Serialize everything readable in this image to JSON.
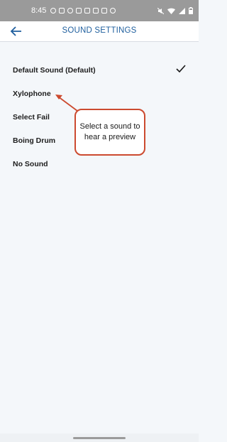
{
  "status_bar": {
    "time": "8:45",
    "icons": [
      "profile-icon",
      "mail-icon",
      "at-icon",
      "tower-icon",
      "media-icon",
      "clipboard-icon",
      "image-icon",
      "lock-icon"
    ],
    "right_icons": [
      "mute-icon",
      "wifi-icon",
      "signal-icon",
      "battery-icon"
    ]
  },
  "header": {
    "title": "SOUND SETTINGS",
    "back_icon": "back-arrow-icon"
  },
  "sounds": [
    {
      "label": "Default Sound (Default)",
      "selected": true
    },
    {
      "label": "Xylophone",
      "selected": false
    },
    {
      "label": "Select Fail",
      "selected": false
    },
    {
      "label": "Boing Drum",
      "selected": false
    },
    {
      "label": "No Sound",
      "selected": false
    }
  ],
  "callout": {
    "text": "Select a sound to hear a preview"
  },
  "colors": {
    "accent": "#1f5f9e",
    "callout_border": "#cc4a2f",
    "background": "#f4f7fa"
  }
}
